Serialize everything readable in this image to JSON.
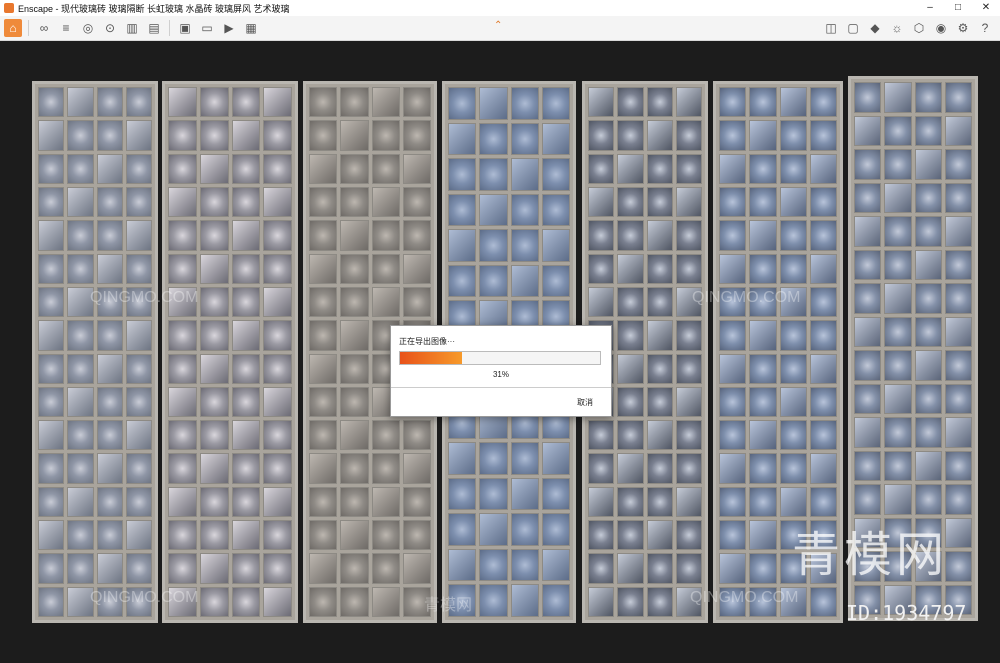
{
  "window": {
    "title": "Enscape - 现代玻璃砖 玻璃隔断 长虹玻璃 水晶砖 玻璃屏风 艺术玻璃",
    "minimize": "–",
    "maximize": "□",
    "close": "✕"
  },
  "toolbar": {
    "left_icons": [
      "home-icon",
      "link-icon",
      "list-icon",
      "binoculars-icon",
      "map-pin-icon",
      "building-icon",
      "clapper-icon",
      "image-export-icon",
      "panorama-icon",
      "video-export-icon",
      "batch-export-icon"
    ],
    "right_icons": [
      "map-icon",
      "screen-icon",
      "object-icon",
      "sun-icon",
      "asset-icon",
      "hide-icon",
      "settings-icon",
      "help-icon"
    ]
  },
  "watermark": {
    "text": "QINGMO.COM",
    "cn_text": "青模网",
    "brand": "青模网",
    "id": "ID:1934797"
  },
  "export_dialog": {
    "title": "正在导出图像···",
    "progress": 0.31,
    "percent_text": "31%",
    "cancel_label": "取消"
  },
  "colors": {
    "accent": "#ef8a3a",
    "progress_start": "#e8521a",
    "progress_end": "#f79a2a"
  }
}
